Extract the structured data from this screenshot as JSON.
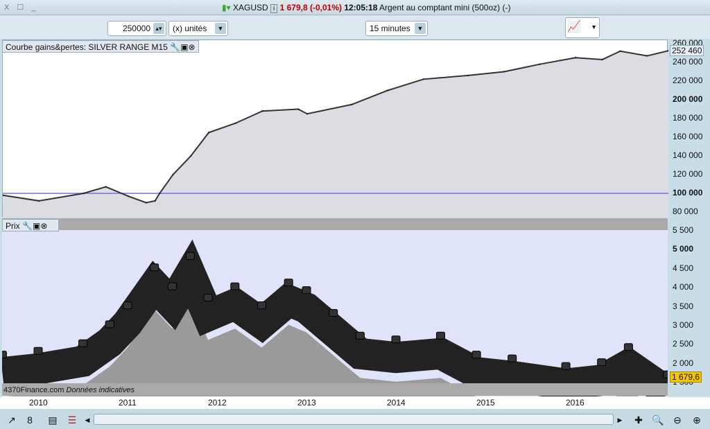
{
  "window": {
    "controls": "X ☐ _",
    "symbol": "XAGUSD",
    "info_icon": "i",
    "price_change": "1 679,8 (-0,01%)",
    "time": "12:05:18",
    "description": "Argent au comptant mini (500oz) (-)"
  },
  "toolbar": {
    "quantity": "250000",
    "unit": "(x) unités",
    "timeframe": "15 minutes"
  },
  "equity_panel": {
    "title": "Courbe gains&pertes: SILVER RANGE M15",
    "current_value": "252 460",
    "y_ticks": [
      "260 000",
      "240 000",
      "220 000",
      "200 000",
      "180 000",
      "160 000",
      "140 000",
      "120 000",
      "100 000",
      "80 000"
    ],
    "bold_ticks": [
      "200 000",
      "100 000"
    ],
    "reference_line": 100000,
    "line_color": "#7070e0"
  },
  "price_panel": {
    "title": "Prix",
    "current_value": "1 679,6",
    "y_ticks": [
      "5 500",
      "5 000",
      "4 500",
      "4 000",
      "3 500",
      "3 000",
      "2 500",
      "2 000",
      "1 500"
    ],
    "bold_ticks": [
      "5 000"
    ],
    "watermark": "Finance.com",
    "watermark2": "Données indicatives",
    "corner": "4370"
  },
  "x_axis": {
    "labels": [
      "2010",
      "2011",
      "2012",
      "2013",
      "2014",
      "2015",
      "2016"
    ]
  },
  "chart_data": [
    {
      "type": "area",
      "title": "Courbe gains&pertes: SILVER RANGE M15",
      "x": [
        2009.6,
        2010.0,
        2010.5,
        2010.75,
        2011.0,
        2011.2,
        2011.3,
        2011.35,
        2011.5,
        2011.7,
        2011.9,
        2012.2,
        2012.5,
        2012.9,
        2013.0,
        2013.5,
        2013.9,
        2014.3,
        2014.8,
        2015.2,
        2015.6,
        2016.0,
        2016.3,
        2016.5,
        2016.8,
        2017.04
      ],
      "y": [
        98000,
        92000,
        100000,
        107000,
        97000,
        90000,
        92000,
        100000,
        120000,
        140000,
        165000,
        175000,
        188000,
        190000,
        185000,
        195000,
        210000,
        222000,
        226000,
        230000,
        238000,
        245000,
        243000,
        252000,
        247000,
        252460
      ],
      "ylim": [
        80000,
        260000
      ]
    },
    {
      "type": "line",
      "title": "Prix",
      "x": [
        2009.6,
        2010.0,
        2010.5,
        2010.8,
        2011.0,
        2011.3,
        2011.5,
        2011.7,
        2011.9,
        2012.2,
        2012.5,
        2012.8,
        2013.0,
        2013.3,
        2013.6,
        2014.0,
        2014.5,
        2014.9,
        2015.3,
        2015.9,
        2016.3,
        2016.6,
        2017.04
      ],
      "y": [
        2200,
        2300,
        2500,
        3000,
        3500,
        4500,
        4000,
        4800,
        3700,
        4000,
        3500,
        4100,
        3900,
        3300,
        2700,
        2600,
        2700,
        2200,
        2100,
        1900,
        2000,
        2400,
        1680
      ],
      "ylim": [
        1500,
        5500
      ]
    }
  ]
}
